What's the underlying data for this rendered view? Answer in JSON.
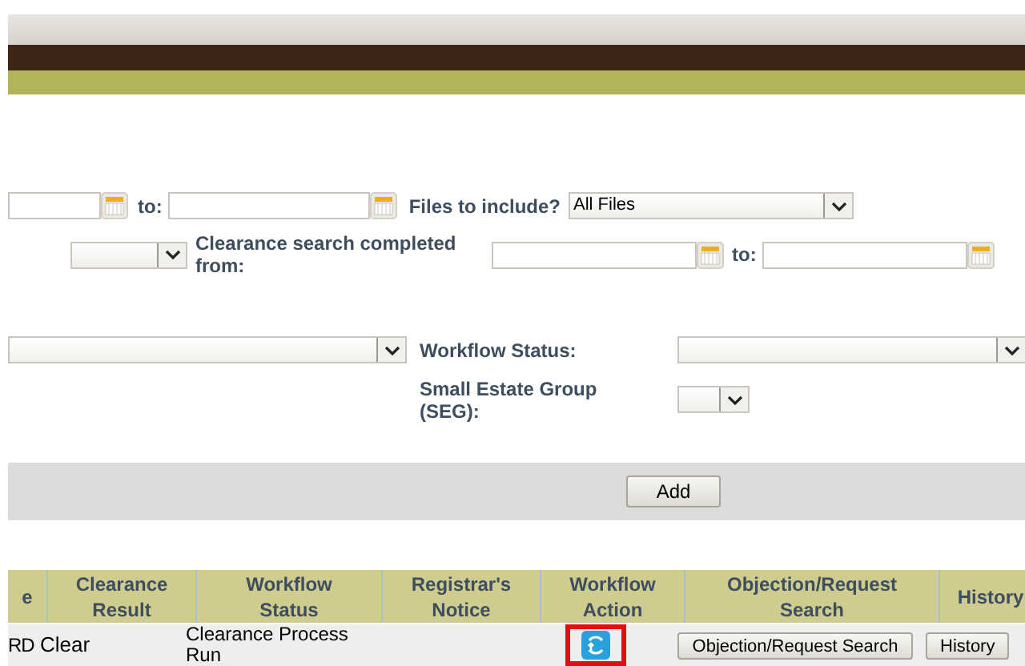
{
  "filters": {
    "date_to_label": "to:",
    "files_to_include": {
      "label": "Files to include?",
      "value": "All Files"
    },
    "clearance_completed": {
      "label": "Clearance search completed from:",
      "to_label": "to:"
    },
    "workflow_status": {
      "label": "Workflow Status:"
    },
    "seg": {
      "label": "Small Estate Group (SEG):"
    }
  },
  "add_button": "Add",
  "table": {
    "columns": [
      "e",
      "Clearance Result",
      "Workflow Status",
      "Registrar's Notice",
      "Workflow Action",
      "Objection/Request Search",
      "History"
    ],
    "rows": [
      {
        "column_1": "RD",
        "clearance_result": "Clear",
        "workflow_status": "Clearance Process Run",
        "action_highlighted": true,
        "objection_button": "Objection/Request Search",
        "history_button": "History"
      }
    ]
  }
}
